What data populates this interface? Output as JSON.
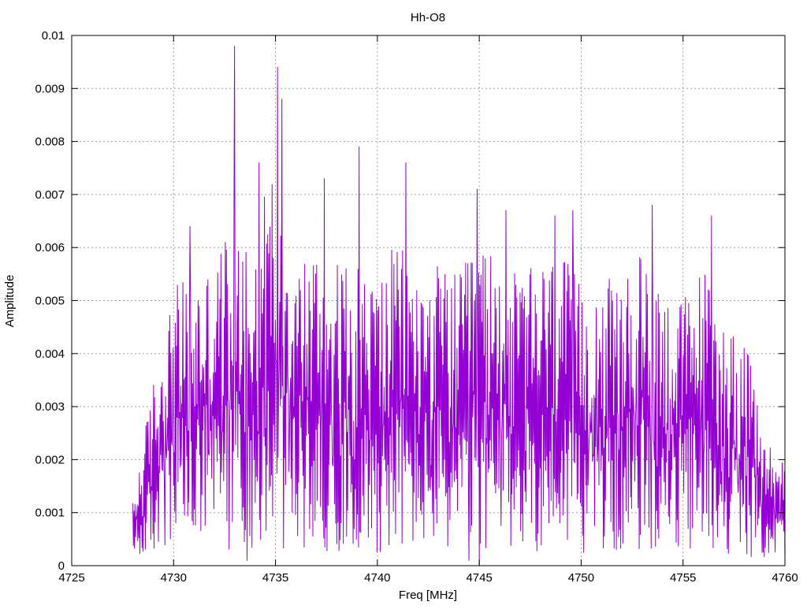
{
  "chart_data": {
    "type": "line",
    "title": "Hh-O8",
    "xlabel": "Freq [MHz]",
    "ylabel": "Amplitude",
    "xlim": [
      4725,
      4760
    ],
    "ylim": [
      0,
      0.01
    ],
    "x_ticks": [
      "4725",
      "4730",
      "4735",
      "4740",
      "4745",
      "4750",
      "4755",
      "4760"
    ],
    "y_ticks": [
      "0",
      "0.001",
      "0.002",
      "0.003",
      "0.004",
      "0.005",
      "0.006",
      "0.007",
      "0.008",
      "0.009",
      "0.01"
    ],
    "grid": true,
    "legend": "none",
    "series": [
      {
        "color": "#9400d3",
        "x_start": 4728.0,
        "x_end": 4760.0,
        "points": 1200,
        "envelope": {
          "x": [
            4728.0,
            4729.0,
            4730.0,
            4731.0,
            4732.0,
            4733.0,
            4734.0,
            4735.0,
            4736.0,
            4737.0,
            4738.0,
            4739.0,
            4740.0,
            4741.0,
            4742.0,
            4743.0,
            4744.0,
            4745.0,
            4746.0,
            4747.0,
            4748.0,
            4749.0,
            4750.0,
            4751.0,
            4752.0,
            4753.0,
            4754.0,
            4755.0,
            4756.0,
            4757.0,
            4758.0,
            4759.0,
            4760.0
          ],
          "y": [
            0.0011,
            0.0032,
            0.0048,
            0.005,
            0.0052,
            0.0062,
            0.006,
            0.007,
            0.0054,
            0.0055,
            0.0052,
            0.0052,
            0.005,
            0.0056,
            0.005,
            0.0052,
            0.005,
            0.0056,
            0.0052,
            0.005,
            0.0052,
            0.0054,
            0.0048,
            0.005,
            0.0048,
            0.0054,
            0.0048,
            0.0046,
            0.0052,
            0.0042,
            0.004,
            0.0022,
            0.0018
          ]
        },
        "peaks": [
          {
            "x": 4730.8,
            "y": 0.0064
          },
          {
            "x": 4733.0,
            "y": 0.0098
          },
          {
            "x": 4734.2,
            "y": 0.0076
          },
          {
            "x": 4735.1,
            "y": 0.0094
          },
          {
            "x": 4735.3,
            "y": 0.0088
          },
          {
            "x": 4737.4,
            "y": 0.0073
          },
          {
            "x": 4739.1,
            "y": 0.0079
          },
          {
            "x": 4741.4,
            "y": 0.0076
          },
          {
            "x": 4744.9,
            "y": 0.0071
          },
          {
            "x": 4746.3,
            "y": 0.0067
          },
          {
            "x": 4748.7,
            "y": 0.0066
          },
          {
            "x": 4749.6,
            "y": 0.0067
          },
          {
            "x": 4753.5,
            "y": 0.0068
          },
          {
            "x": 4756.4,
            "y": 0.0066
          },
          {
            "x": 4733.6,
            "y": 0.0001
          },
          {
            "x": 4744.5,
            "y": 0.0001
          },
          {
            "x": 4745.0,
            "y": 0.0
          }
        ]
      }
    ]
  }
}
